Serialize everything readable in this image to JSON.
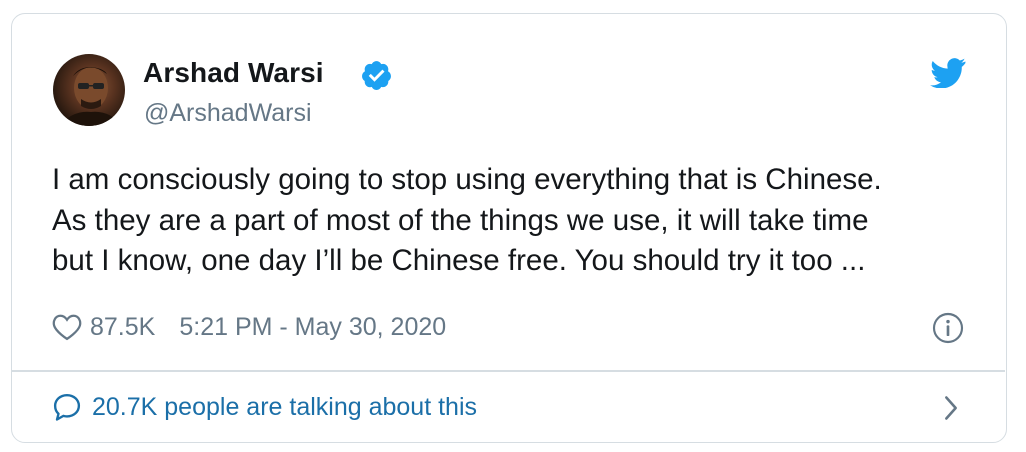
{
  "tweet": {
    "author": {
      "display_name": "Arshad Warsi",
      "handle": "@ArshadWarsi",
      "verified": true,
      "avatar_icon": "profile-photo"
    },
    "brand_icon": "twitter-bird-icon",
    "text_lines": [
      "I am consciously going to stop using everything that is Chinese.",
      "As they are a part of most of the things we use, it will take time",
      "but I know, one day I’ll be Chinese free. You should try it too ..."
    ],
    "likes": "87.5K",
    "timestamp": "5:21 PM - May 30, 2020",
    "conversation_label": "20.7K people are talking about this"
  },
  "colors": {
    "brand_blue": "#1da1f2",
    "text_primary": "#14171a",
    "text_secondary": "#657786",
    "link_blue": "#1b6fa8",
    "border": "#d6dde2"
  }
}
